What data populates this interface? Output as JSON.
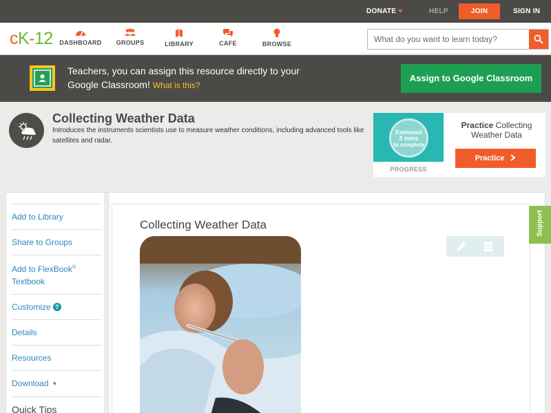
{
  "topbar": {
    "donate": "DONATE",
    "help": "HELP",
    "join": "JOIN",
    "signin": "SIGN IN"
  },
  "logo": {
    "c": "c",
    "k": "K",
    "dash": "-",
    "num": "12"
  },
  "nav": {
    "dashboard": "DASHBOARD",
    "groups": "GROUPS",
    "library": "LIBRARY",
    "cafe": "CAFE",
    "browse": "BROWSE"
  },
  "search": {
    "placeholder": "What do you want to learn today?"
  },
  "banner": {
    "text": "Teachers, you can assign this resource directly to your Google Classroom!",
    "what_link": "What is this?",
    "assign_button": "Assign to Google Classroom"
  },
  "concept": {
    "title": "Collecting Weather Data",
    "description": "Introduces the instruments scientists use to measure weather conditions, including advanced tools like satellites and radar."
  },
  "practice_card": {
    "estimated": "Estimated",
    "mins": "3 mins",
    "to_complete": "to complete",
    "progress_label": "PROGRESS",
    "heading_bold": "Practice",
    "heading_rest": "Collecting Weather Data",
    "button": "Practice"
  },
  "sidebar": {
    "add_library": "Add to Library",
    "share_groups": "Share to Groups",
    "add_flexbook": "Add to FlexBook",
    "flexbook_reg": "®",
    "flexbook_textbook": "Textbook",
    "customize": "Customize",
    "customize_help": "?",
    "details": "Details",
    "resources": "Resources",
    "download": "Download",
    "download_caret": "▼",
    "quick_tips": "Quick Tips"
  },
  "main": {
    "title": "Collecting Weather Data"
  },
  "support": "Support",
  "colors": {
    "accent_orange": "#f15d2a",
    "dark_bar": "#4b4a47",
    "google_green": "#1e9e52",
    "link_blue": "#2c87b9",
    "support_green": "#8cc152"
  },
  "icons": [
    "heart-icon",
    "dashboard-icon",
    "groups-icon",
    "library-icon",
    "cafe-icon",
    "browse-icon",
    "search-icon",
    "google-classroom-icon",
    "weather-cloud-icon",
    "chevron-right-icon",
    "pencil-icon",
    "notes-icon",
    "help-circle-icon",
    "caret-down-icon"
  ]
}
